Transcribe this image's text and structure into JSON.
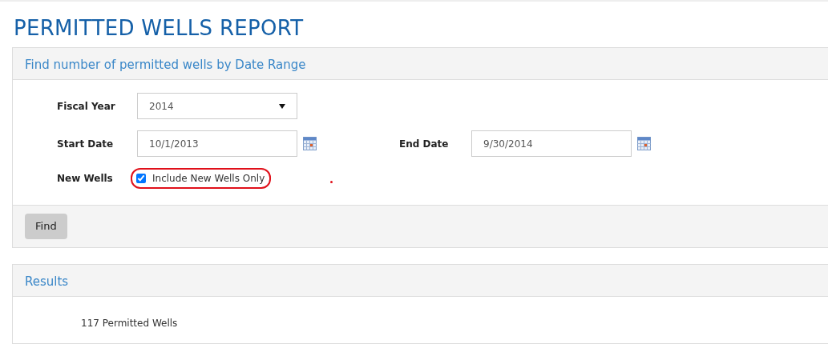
{
  "page_title": "PERMITTED WELLS REPORT",
  "search_panel": {
    "heading": "Find number of permitted wells by Date Range",
    "fiscal_year": {
      "label": "Fiscal Year",
      "value": "2014"
    },
    "start_date": {
      "label": "Start Date",
      "value": "10/1/2013"
    },
    "end_date": {
      "label": "End Date",
      "value": "9/30/2014"
    },
    "new_wells": {
      "label": "New Wells",
      "option": "Include New Wells Only",
      "checked": true
    },
    "button": "Find"
  },
  "results_panel": {
    "heading": "Results",
    "text": "117 Permitted Wells"
  }
}
